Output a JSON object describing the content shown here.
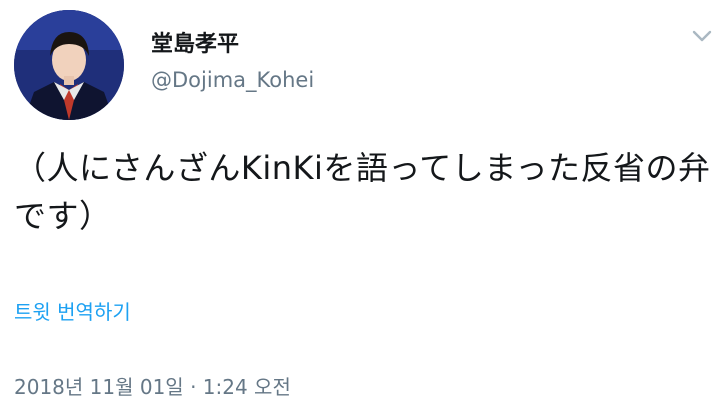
{
  "author": {
    "display_name": "堂島孝平",
    "handle": "@Dojima_Kohei"
  },
  "tweet": {
    "text": "（人にさんざんKinKiを語ってしまった反省の弁です）",
    "translate_label": "트윗 번역하기",
    "timestamp": "2018년 11월 01일 · 1:24 오전"
  },
  "icons": {
    "menu": "chevron-down-icon",
    "avatar": "profile-photo"
  },
  "colors": {
    "text": "#14171a",
    "secondary": "#657786",
    "link": "#1da1f2"
  }
}
